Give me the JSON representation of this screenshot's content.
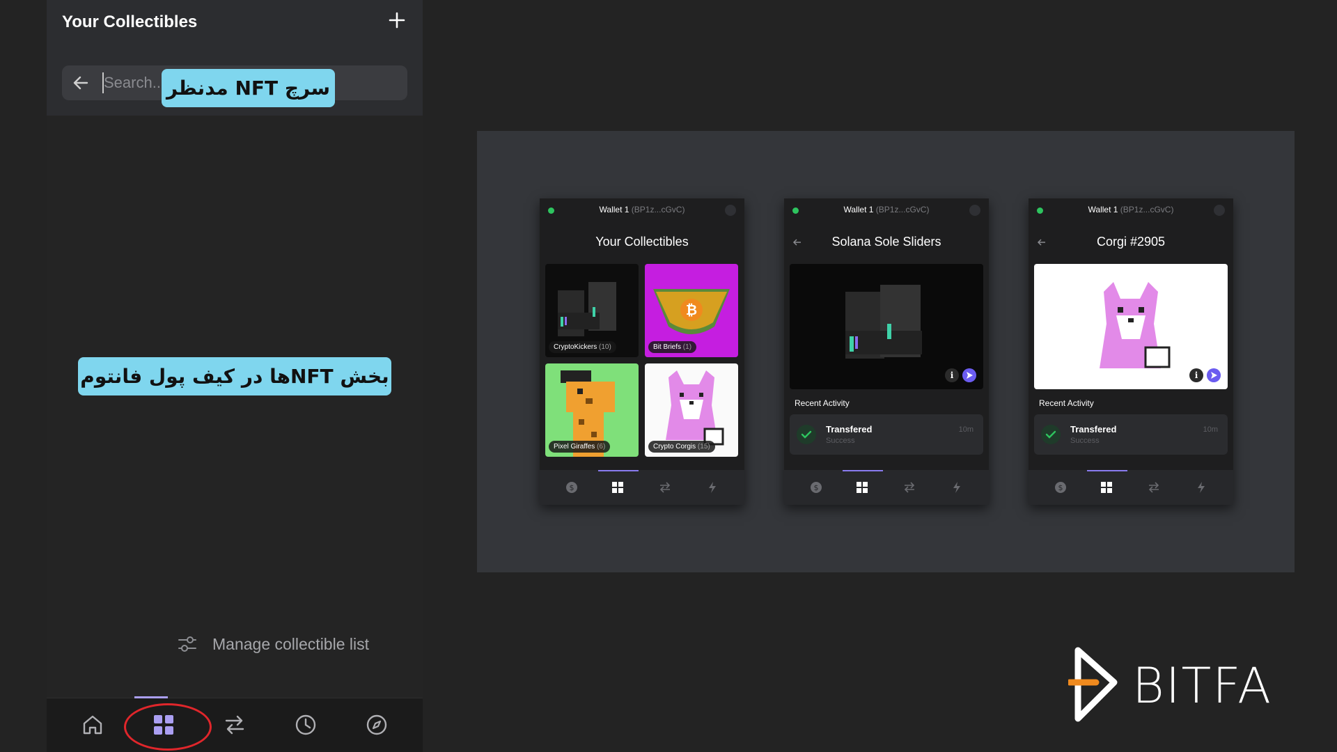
{
  "left_panel": {
    "title": "Your Collectibles",
    "search": {
      "placeholder": "Search..."
    },
    "manage_label": "Manage collectible list",
    "nav": [
      "home-icon",
      "grid-icon",
      "swap-icon",
      "history-icon",
      "explore-icon"
    ]
  },
  "annotations": {
    "search_tip": "سرچ NFT مدنظر",
    "section_tip": "بخش NFTها در کیف پول فانتوم"
  },
  "phones": [
    {
      "wallet": "Wallet 1",
      "address": "(BP1z...cGvC)",
      "title": "Your Collectibles",
      "collections": [
        {
          "name": "CryptoKickers",
          "count": "(10)"
        },
        {
          "name": "Bit Briefs",
          "count": "(1)"
        },
        {
          "name": "Pixel Giraffes",
          "count": "(6)"
        },
        {
          "name": "Crypto Corgis",
          "count": "(15)"
        }
      ]
    },
    {
      "wallet": "Wallet 1",
      "address": "(BP1z...cGvC)",
      "title": "Solana Sole Sliders",
      "recent_label": "Recent Activity",
      "activity": {
        "title": "Transfered",
        "status": "Success",
        "time": "10m"
      }
    },
    {
      "wallet": "Wallet 1",
      "address": "(BP1z...cGvC)",
      "title": "Corgi #2905",
      "recent_label": "Recent Activity",
      "activity": {
        "title": "Transfered",
        "status": "Success",
        "time": "10m"
      }
    }
  ],
  "logo": {
    "text": "BITFA"
  },
  "colors": {
    "accent": "#ab9ff2",
    "tooltip": "#7fd6ee",
    "success": "#2ec45f",
    "highlight": "#e0262b"
  }
}
